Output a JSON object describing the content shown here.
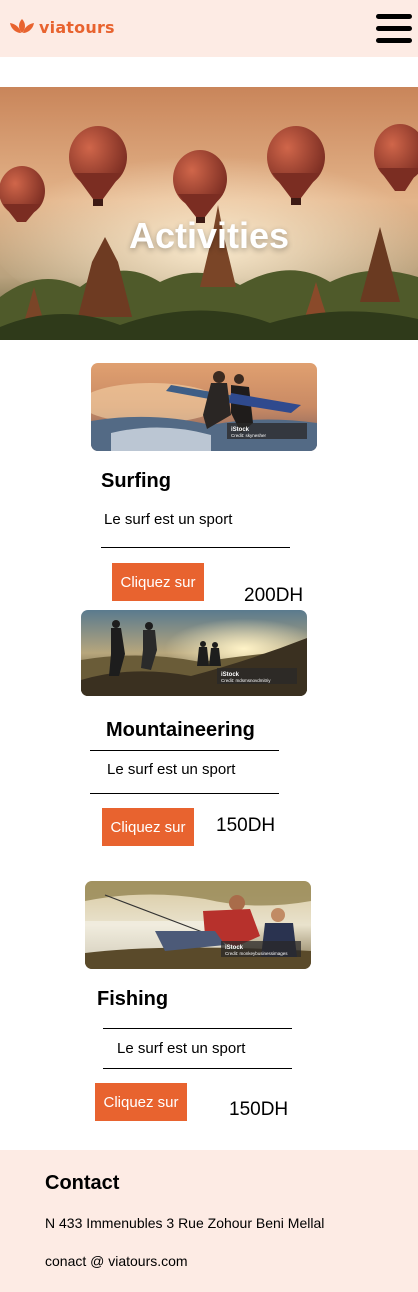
{
  "header": {
    "brand": "viatours",
    "logo_icon": "lotus-flower-icon",
    "menu_icon": "hamburger-menu-icon",
    "accent_color": "#e8632f",
    "background_color": "#fdebe4"
  },
  "hero": {
    "title": "Activities",
    "image": "hot-air-balloons-over-temples"
  },
  "activities": [
    {
      "title": "Surfing",
      "description": "Le surf est un sport",
      "button_label": "Cliquez sur",
      "price": "200DH",
      "image": "surfers-running-into-sea",
      "watermark": "iStock",
      "credit": "Credit: skynesher"
    },
    {
      "title": "Mountaineering",
      "description": "Le surf est un sport",
      "button_label": "Cliquez sur",
      "price": "150DH",
      "image": "hikers-on-mountain-ridge",
      "watermark": "iStock",
      "credit": "Credit: mdsmsnovdmitriy"
    },
    {
      "title": "Fishing",
      "description": "Le surf est un sport",
      "button_label": "Cliquez sur",
      "price": "150DH",
      "image": "father-and-son-fishing",
      "watermark": "iStock",
      "credit": "Credit: monkeybusinessimages"
    }
  ],
  "footer": {
    "title": "Contact",
    "address": "N 433 Immenubles 3 Rue Zohour Beni Mellal",
    "email": "conact @ viatours.com"
  }
}
